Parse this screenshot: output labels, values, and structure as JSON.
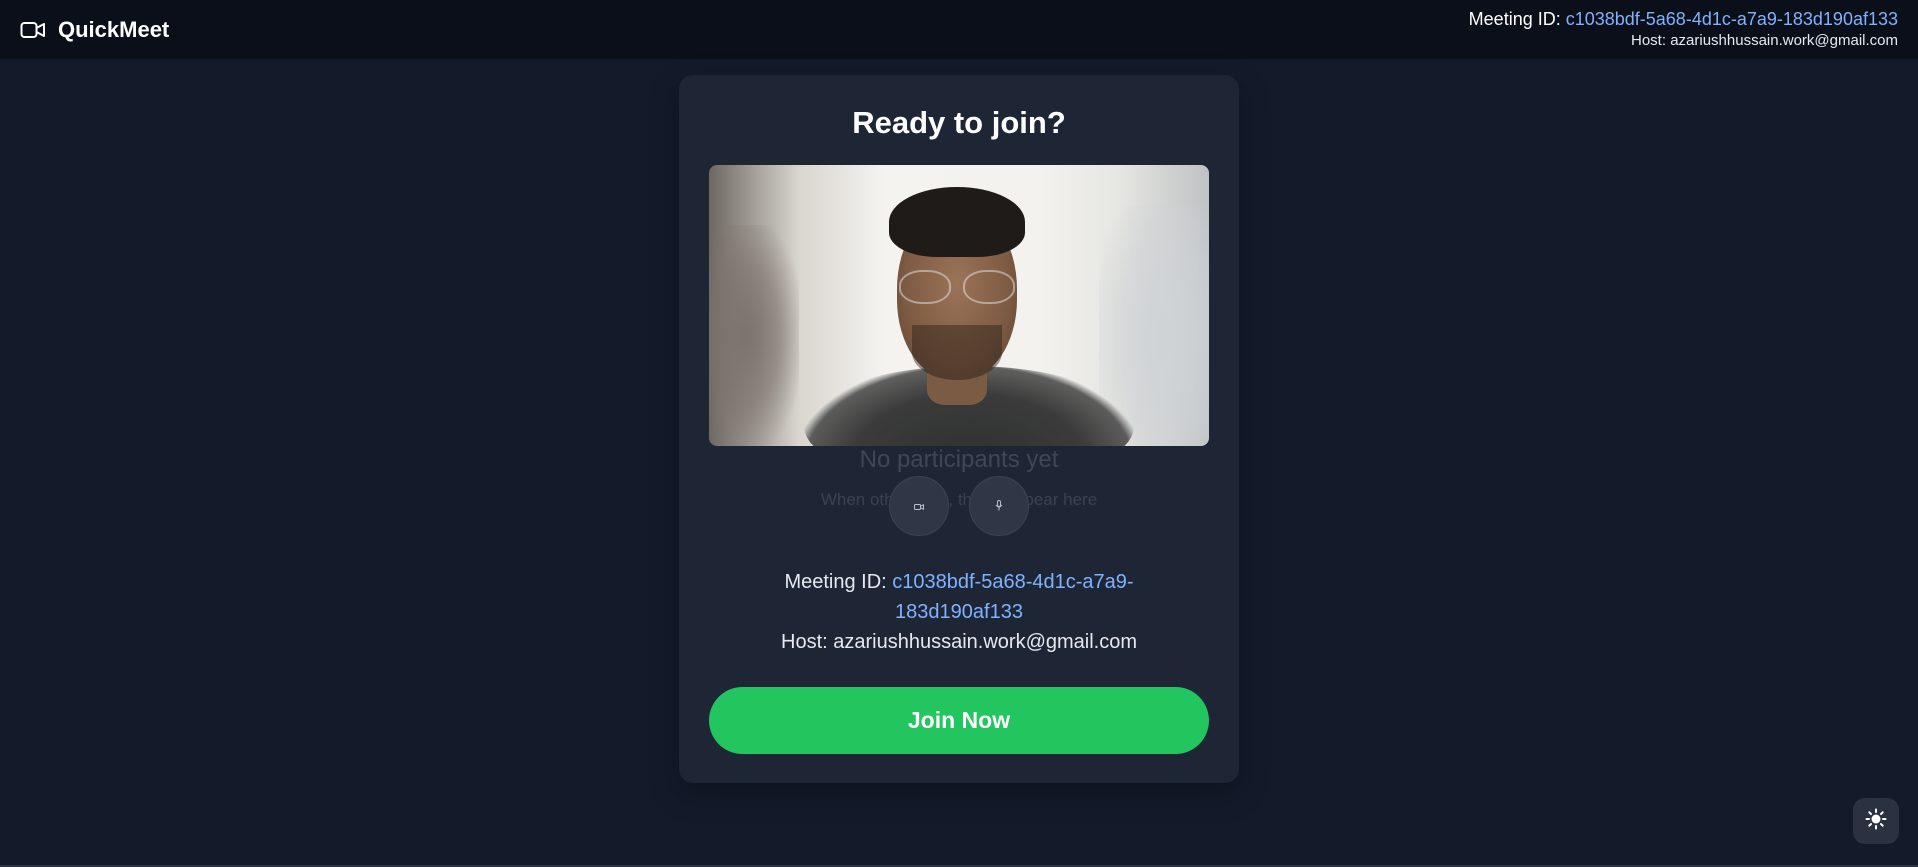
{
  "app": {
    "name": "QuickMeet",
    "logo_icon": "video-camera-icon"
  },
  "header": {
    "meeting_id_label": "Meeting ID: ",
    "meeting_id": "c1038bdf-5a68-4d1c-a7a9-183d190af133",
    "host_label": "Host: ",
    "host": "azariushhussain.work@gmail.com"
  },
  "card": {
    "title": "Ready to join?",
    "empty_title": "No participants yet",
    "empty_subtitle": "When others join, they'll appear here",
    "controls": {
      "camera_icon": "camera-icon",
      "mic_icon": "microphone-icon"
    },
    "meeting_id_label": "Meeting ID: ",
    "meeting_id": "c1038bdf-5a68-4d1c-a7a9-183d190af133",
    "host_label": "Host: ",
    "host": "azariushhussain.work@gmail.com",
    "join_label": "Join Now"
  },
  "theme_toggle": {
    "icon": "sun-icon"
  },
  "colors": {
    "background": "#131a2a",
    "topbar": "#0b0f19",
    "card": "#1e2636",
    "accent_link": "#7fb2ff",
    "join_button": "#22c55e"
  }
}
